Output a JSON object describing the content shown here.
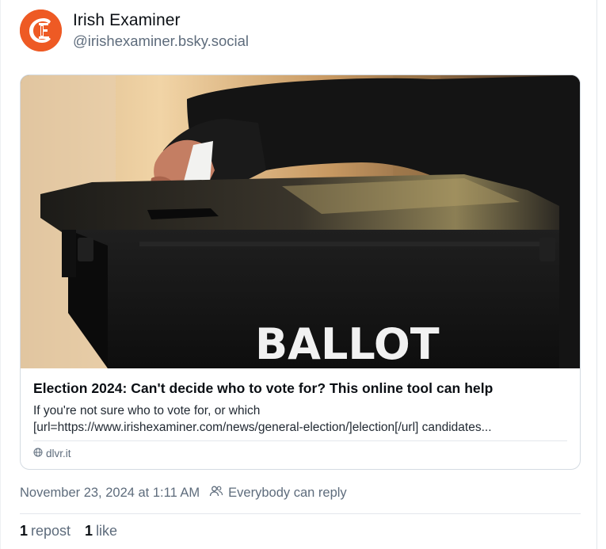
{
  "author": {
    "display_name": "Irish Examiner",
    "handle": "@irishexaminer.bsky.social"
  },
  "embed": {
    "image_text": "BALLOT",
    "title": "Election 2024: Can't decide who to vote for? This online tool can help",
    "description_line1": "If you're not sure who to vote for, or which",
    "description_line2": "[url=https://www.irishexaminer.com/news/general-election/]election[/url] candidates...",
    "source": "dlvr.it"
  },
  "meta": {
    "timestamp": "November 23, 2024 at 1:11 AM",
    "reply_setting": "Everybody can reply"
  },
  "stats": {
    "reposts_count": "1",
    "reposts_label": "repost",
    "likes_count": "1",
    "likes_label": "like"
  },
  "colors": {
    "avatar": "#ee5a24",
    "muted_text": "#5e6c7c",
    "border": "#d4dbe2"
  },
  "icons": {
    "avatar": "irish-examiner-logo",
    "source": "globe-icon",
    "reply_setting": "people-icon"
  }
}
